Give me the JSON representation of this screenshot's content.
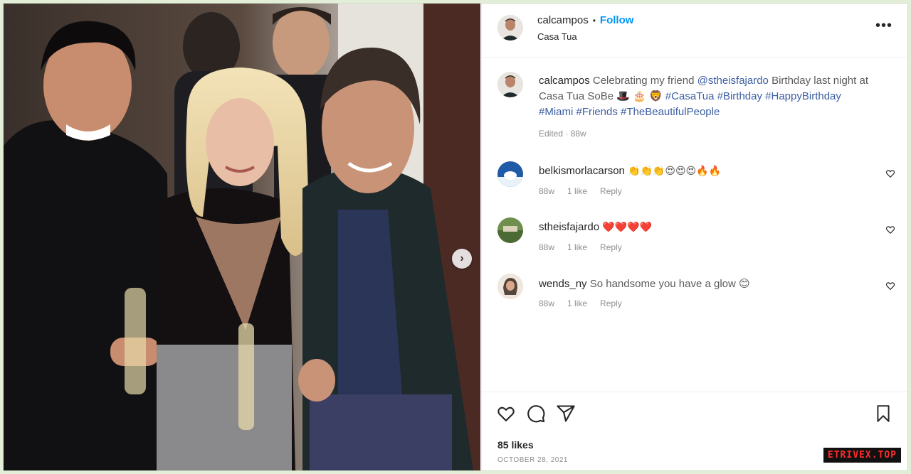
{
  "post": {
    "username": "calcampos",
    "dot": "•",
    "follow_label": "Follow",
    "location": "Casa Tua",
    "more_icon": "more-horizontal-icon",
    "carousel_next_icon": "chevron-right-icon",
    "carousel_next_glyph": "›"
  },
  "caption": {
    "username": "calcampos",
    "text_1": "Celebrating my friend",
    "mention": "@stheisfajardo",
    "text_2": "Birthday last night at Casa Tua SoBe",
    "emojis": "🎩 🎂 🦁",
    "hashtags_1": "#CasaTua #Birthday",
    "hashtags_2": "#HappyBirthday #Miami #Friends #TheBeautifulPeople",
    "edited": "Edited · 88w"
  },
  "comments": [
    {
      "username": "belkismorlacarson",
      "text": "👏👏👏😍😍😍🔥🔥",
      "age": "88w",
      "likes": "1 like",
      "reply": "Reply"
    },
    {
      "username": "stheisfajardo",
      "text": "❤️❤️❤️❤️",
      "age": "88w",
      "likes": "1 like",
      "reply": "Reply"
    },
    {
      "username": "wends_ny",
      "text": "So handsome you have a glow 😊",
      "age": "88w",
      "likes": "1 like",
      "reply": "Reply"
    }
  ],
  "footer": {
    "likes": "85 likes",
    "date": "OCTOBER 28, 2021"
  },
  "watermark": "ETRIVEX.TOP",
  "colors": {
    "follow": "#0095f6",
    "hashtag": "#3c5fa3",
    "muted": "#8e8e8e"
  }
}
